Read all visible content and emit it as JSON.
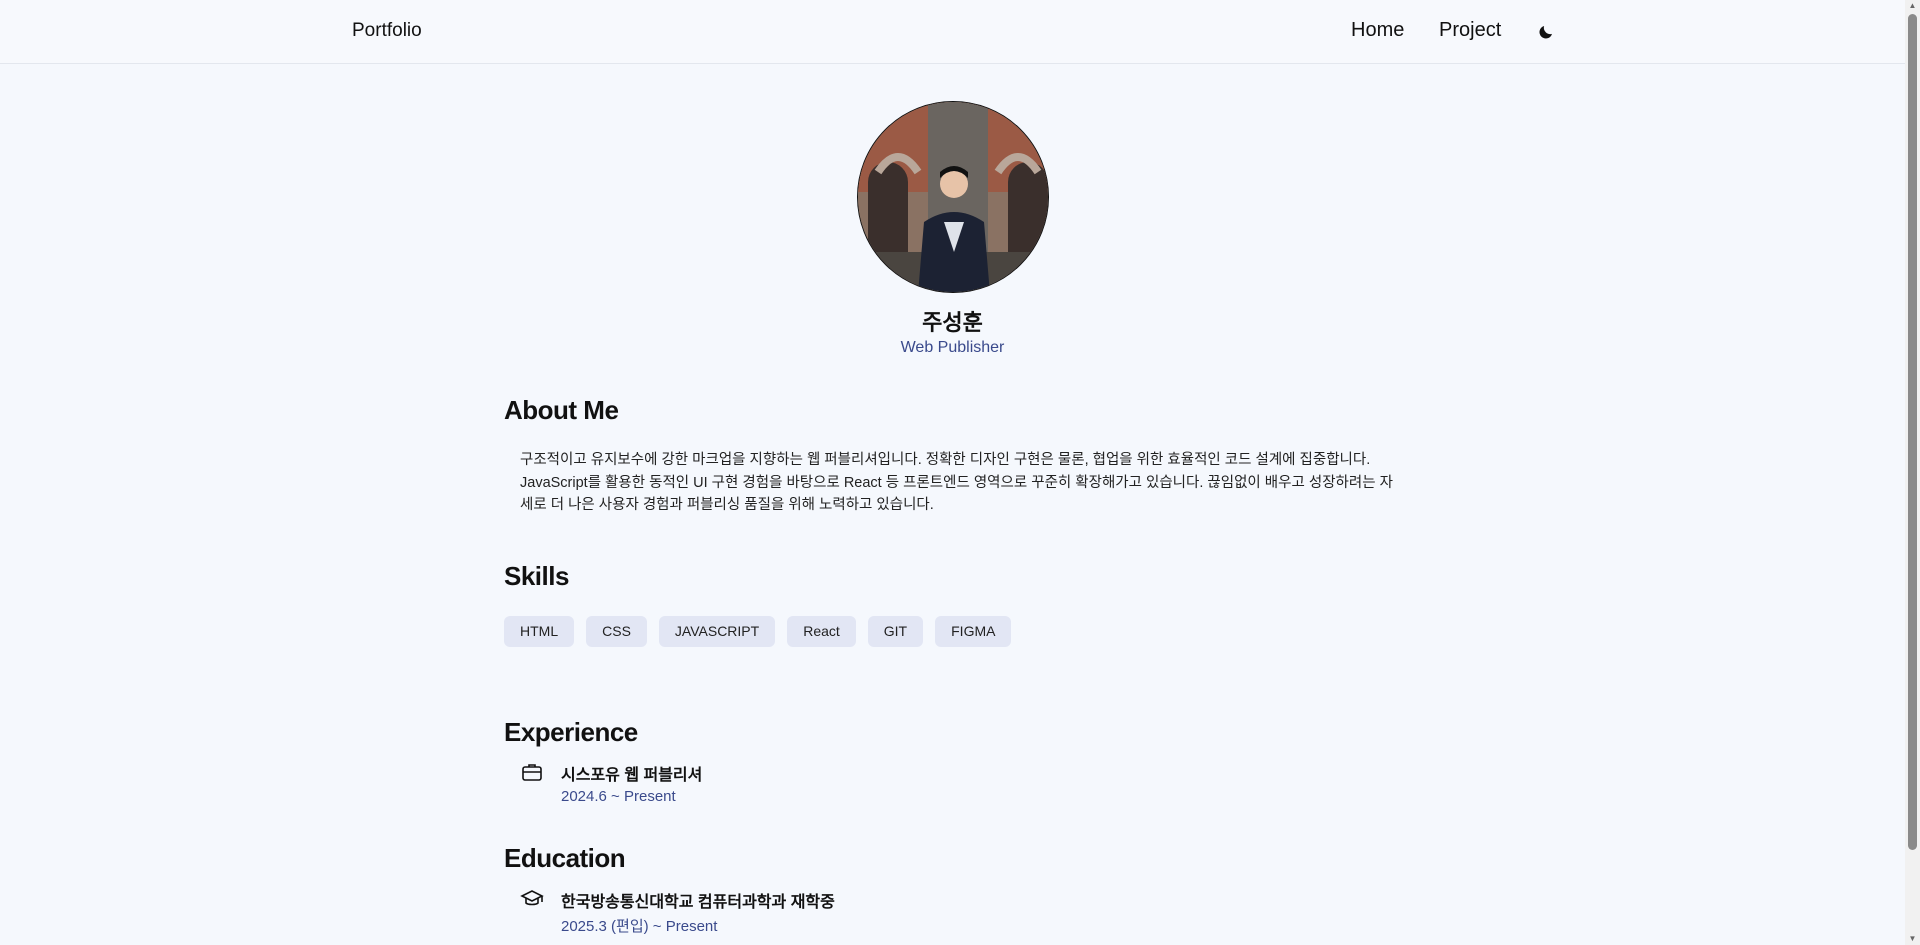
{
  "header": {
    "brand": "Portfolio",
    "nav": {
      "home": "Home",
      "project": "Project"
    },
    "theme_icon": "moon-icon"
  },
  "profile": {
    "name": "주성훈",
    "role": "Web Publisher"
  },
  "about": {
    "title": "About Me",
    "text": "구조적이고 유지보수에 강한 마크업을 지향하는 웹 퍼블리셔입니다. 정확한 디자인 구현은 물론, 협업을 위한 효율적인 코드 설계에 집중합니다. JavaScript를 활용한 동적인 UI 구현 경험을 바탕으로 React 등 프론트엔드 영역으로 꾸준히 확장해가고 있습니다. 끊임없이 배우고 성장하려는 자세로 더 나은 사용자 경험과 퍼블리싱 품질을 위해 노력하고 있습니다."
  },
  "skills": {
    "title": "Skills",
    "items": [
      "HTML",
      "CSS",
      "JAVASCRIPT",
      "React",
      "GIT",
      "FIGMA"
    ]
  },
  "experience": {
    "title": "Experience",
    "icon": "briefcase-icon",
    "item_title": "시스포유 웹 퍼블리셔",
    "item_date": "2024.6 ~ Present"
  },
  "education": {
    "title": "Education",
    "icon": "graduation-cap-icon",
    "item_title": "한국방송통신대학교 컴퓨터과학과 재학중",
    "item_date": "2025.3 (편입) ~ Present"
  },
  "colors": {
    "background": "#f5f8fd",
    "accent": "#3a4a8c",
    "chip": "#e2e6f4"
  }
}
